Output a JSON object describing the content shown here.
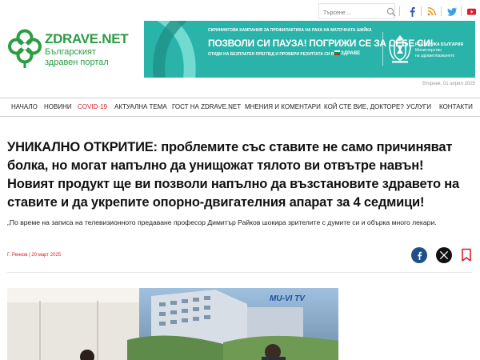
{
  "topbar": {
    "search_placeholder": "Търсене ...",
    "icons": [
      "search-icon",
      "facebook-icon",
      "rss-icon",
      "twitter-icon",
      "youtube-icon"
    ]
  },
  "logo": {
    "name": "ZDRAVE.NET",
    "tagline": "Българският\nздравен портал"
  },
  "banner": {
    "kicker": "СКРИНИНГОВА КАМПАНИЯ ЗА ПРОФИЛАКТИКА НА РАКА НА МАТОЧНАТА ШИЙКА",
    "headline": "ПОЗВОЛИ СИ ПАУЗА! ПОГРИЖИ СЕ ЗА СЕБЕ СИ!",
    "sub": "ОТИДИ НА БЕЗПЛАТЕН ПРЕГЛЕД И ПРОВЕРИ РЕЗУЛТАТА СИ В",
    "brand": "ЗДРАВЕ",
    "ministry_title": "РЕПУБЛИКА БЪЛГАРИЯ",
    "ministry_sub": "Министерство\nна здравеопазването"
  },
  "date": "Вторник, 01 април 2025",
  "nav": {
    "items": [
      {
        "label": "НАЧАЛО"
      },
      {
        "label": "НОВИНИ"
      },
      {
        "label": "COVID-19"
      },
      {
        "label": "АКТУАЛНА ТЕМА"
      },
      {
        "label": "ГОСТ НА ZDRAVE.NET"
      },
      {
        "label": "МНЕНИЯ И КОМЕНТАРИ"
      },
      {
        "label": "КОЙ СТЕ ВИЕ, ДОКТОРЕ?"
      },
      {
        "label": "УСЛУГИ"
      },
      {
        "label": "КОНТАКТИ"
      }
    ]
  },
  "article": {
    "headline": "УНИКАЛНО ОТКРИТИЕ: проблемите със ставите не само причиняват болка, но могат напълно да унищожат тялото ви отвътре навън! Новият продукт ще ви позволи напълно да възстановите здравето на ставите и да укрепите опорно-двигателния апарат за 4 седмици!",
    "lede": "„По време на записа на телевизионното предаване професор Димитър Райков шокира зрителите с думите си и обърка много лекари.",
    "author": "Г. Ренков",
    "date": "20 март 2025"
  },
  "media": {
    "channel_logo": "MU-VI TV"
  },
  "colors": {
    "brand_green": "#2a9d43",
    "accent_red": "#d6212a",
    "banner_teal": "#2ab3a8",
    "facebook": "#1f4f8a"
  }
}
